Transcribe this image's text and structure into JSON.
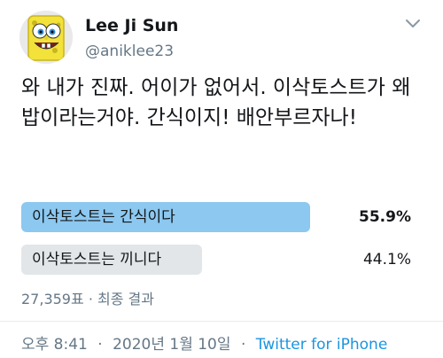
{
  "user": {
    "name": "Lee Ji Sun",
    "handle": "@aniklee23",
    "avatar_icon": "spongebob-avatar"
  },
  "tweet": {
    "text": "와 내가 진짜. 어이가 없어서. 이삭토스트가 왜 밥이라는거야. 간식이지! 배안부르자나!"
  },
  "poll": {
    "options": [
      {
        "label": "이삭토스트는 간식이다",
        "percent": "55.9%",
        "fraction": 0.559,
        "winner": true
      },
      {
        "label": "이삭토스트는 끼니다",
        "percent": "44.1%",
        "fraction": 0.441,
        "winner": false
      }
    ],
    "votes": "27,359표",
    "status": "최종 결과",
    "separator": "·"
  },
  "footer": {
    "time": "오후 8:41",
    "date": "2020년 1월 10일",
    "source": "Twitter for iPhone",
    "separator": "·"
  },
  "colors": {
    "winner_bar": "#8cc8f0",
    "loser_bar": "#e3e6e8",
    "link": "#1b95e0",
    "secondary_text": "#657786"
  }
}
